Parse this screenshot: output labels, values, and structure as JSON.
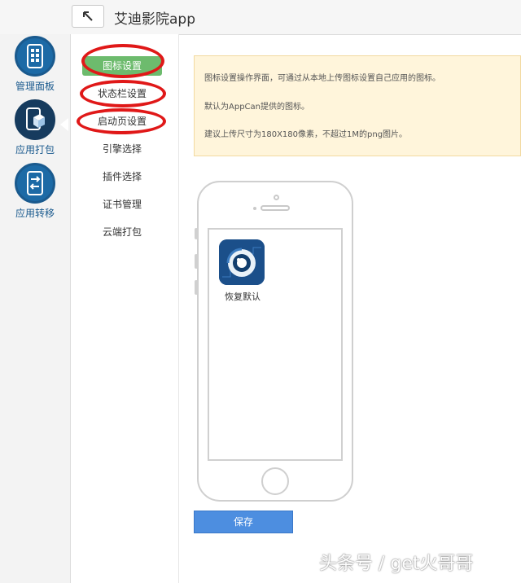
{
  "header": {
    "app_title": "艾迪影院app"
  },
  "rail": {
    "items": [
      {
        "label": "管理面板",
        "icon": "grid-phone-icon"
      },
      {
        "label": "应用打包",
        "icon": "package-phone-icon"
      },
      {
        "label": "应用转移",
        "icon": "transfer-phone-icon"
      }
    ]
  },
  "submenu": {
    "items": [
      {
        "label": "图标设置"
      },
      {
        "label": "状态栏设置"
      },
      {
        "label": "启动页设置"
      },
      {
        "label": "引擎选择"
      },
      {
        "label": "插件选择"
      },
      {
        "label": "证书管理"
      },
      {
        "label": "云端打包"
      }
    ]
  },
  "notice": {
    "lines": [
      "图标设置操作界面，可通过从本地上传图标设置自己应用的图标。",
      "默认为AppCan提供的图标。",
      "建议上传尺寸为180X180像素，不超过1M的png图片。"
    ]
  },
  "preview": {
    "icon_label": "恢复默认"
  },
  "actions": {
    "save_label": "保存"
  },
  "watermark": "头条号 / get火哥哥",
  "colors": {
    "accent_blue": "#1a5a8e",
    "active_green": "#6dbb6d",
    "highlight_red": "#e01818",
    "notice_bg": "#fff5db",
    "save_blue": "#4d8ee0"
  }
}
